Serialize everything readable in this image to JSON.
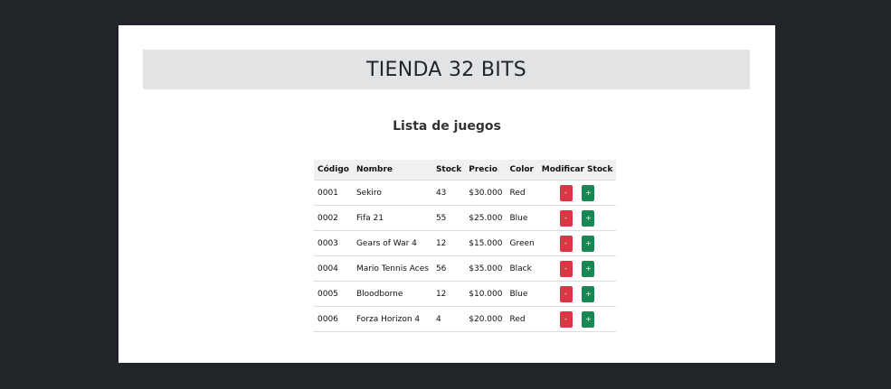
{
  "header": {
    "title": "TIENDA 32 BITS"
  },
  "section": {
    "title": "Lista de juegos"
  },
  "table": {
    "columns": [
      "Código",
      "Nombre",
      "Stock",
      "Precio",
      "Color",
      "Modificar Stock"
    ],
    "rows": [
      {
        "codigo": "0001",
        "nombre": "Sekiro",
        "stock": "43",
        "precio": "$30.000",
        "color": "Red"
      },
      {
        "codigo": "0002",
        "nombre": "Fifa 21",
        "stock": "55",
        "precio": "$25.000",
        "color": "Blue"
      },
      {
        "codigo": "0003",
        "nombre": "Gears of War 4",
        "stock": "12",
        "precio": "$15.000",
        "color": "Green"
      },
      {
        "codigo": "0004",
        "nombre": "Mario Tennis Aces",
        "stock": "56",
        "precio": "$35.000",
        "color": "Black"
      },
      {
        "codigo": "0005",
        "nombre": "Bloodborne",
        "stock": "12",
        "precio": "$10.000",
        "color": "Blue"
      },
      {
        "codigo": "0006",
        "nombre": "Forza Horizon 4",
        "stock": "4",
        "precio": "$20.000",
        "color": "Red"
      }
    ],
    "minus_label": "-",
    "plus_label": "+"
  }
}
